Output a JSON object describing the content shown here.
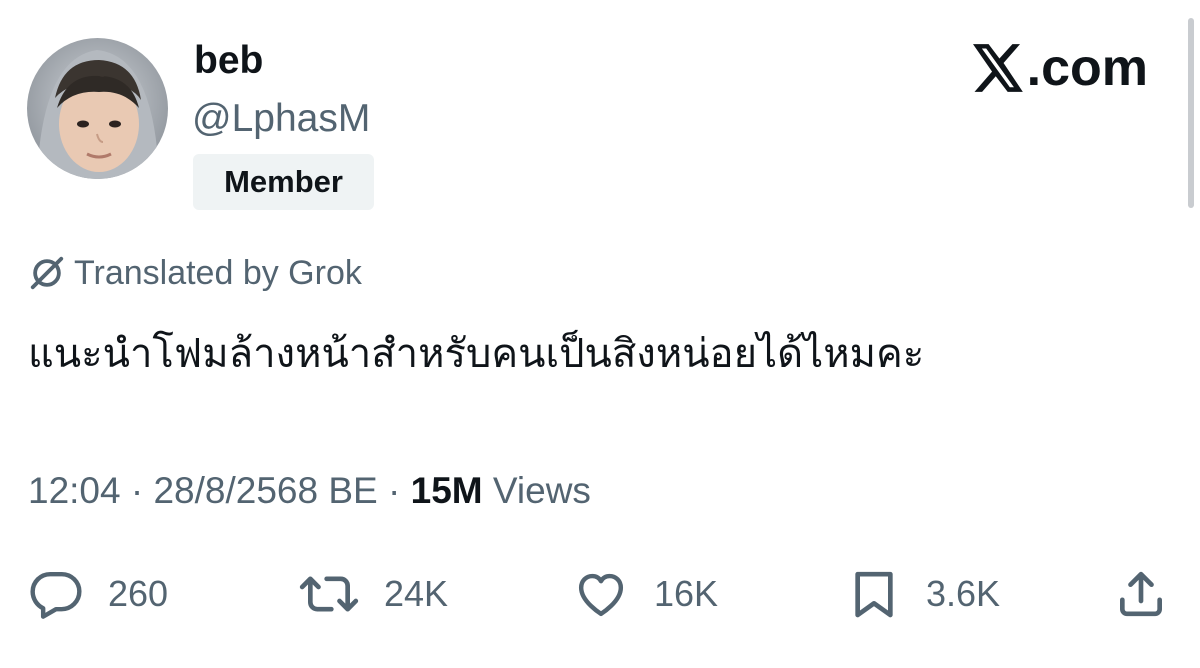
{
  "user": {
    "display_name": "beb",
    "handle": "@LphasM",
    "badge": "Member"
  },
  "brand": {
    "logo_icon": "x-logo-icon",
    "suffix": ".com"
  },
  "translation": {
    "label": "Translated by Grok",
    "icon": "grok-icon"
  },
  "tweet": {
    "text": "แนะนำโฟมล้างหน้าสำหรับคนเป็นสิงหน่อยได้ไหมคะ"
  },
  "meta": {
    "time": "12:04",
    "date": "28/8/2568 BE",
    "views_count": "15M",
    "views_label": "Views"
  },
  "actions": {
    "replies": "260",
    "reposts": "24K",
    "likes": "16K",
    "bookmarks": "3.6K"
  },
  "colors": {
    "text_primary": "#0f1419",
    "text_secondary": "#536471",
    "badge_bg": "#eff3f4"
  }
}
